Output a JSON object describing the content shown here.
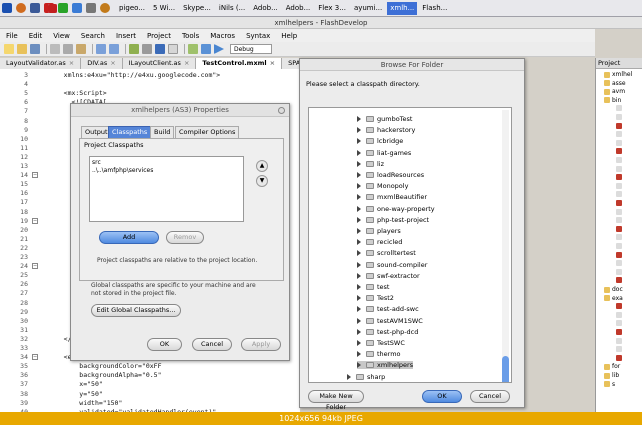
{
  "taskbar": {
    "tasks": [
      {
        "label": "pigeo..."
      },
      {
        "label": "5 Wi..."
      },
      {
        "label": "Skype..."
      },
      {
        "label": "iNils (..."
      },
      {
        "label": "Adob..."
      },
      {
        "label": "Adob..."
      },
      {
        "label": "Flex 3..."
      },
      {
        "label": "ayumi..."
      },
      {
        "label": "xmlh...",
        "active": true
      },
      {
        "label": "Flash..."
      }
    ]
  },
  "window": {
    "title": "xmlhelpers - FlashDevelop"
  },
  "menu": [
    "File",
    "Edit",
    "View",
    "Search",
    "Insert",
    "Project",
    "Tools",
    "Macros",
    "Syntax",
    "Help"
  ],
  "toolbar": {
    "config": "Debug"
  },
  "editor_tabs": [
    {
      "label": "LayoutValidator.as"
    },
    {
      "label": "DIV.as"
    },
    {
      "label": "ILayoutClient.as"
    },
    {
      "label": "TestControl.mxml",
      "active": true
    },
    {
      "label": "SPAN.as"
    }
  ],
  "code_lines": [
    {
      "n": "3",
      "t": "    xmlns:e4xu=\"http://e4xu.googlecode.com\">"
    },
    {
      "n": "4",
      "t": ""
    },
    {
      "n": "5",
      "t": "    <mx:Script>"
    },
    {
      "n": "6",
      "t": "      <![CDATA["
    },
    {
      "n": "7",
      "t": ""
    },
    {
      "n": "8",
      "t": ""
    },
    {
      "n": "9",
      "t": ""
    },
    {
      "n": "10",
      "t": ""
    },
    {
      "n": "11",
      "t": ""
    },
    {
      "n": "12",
      "t": ""
    },
    {
      "n": "13",
      "t": ""
    },
    {
      "n": "14",
      "t": ""
    },
    {
      "n": "15",
      "t": ""
    },
    {
      "n": "16",
      "t": ""
    },
    {
      "n": "17",
      "t": ""
    },
    {
      "n": "18",
      "t": ""
    },
    {
      "n": "19",
      "t": ""
    },
    {
      "n": "20",
      "t": ""
    },
    {
      "n": "21",
      "t": ""
    },
    {
      "n": "22",
      "t": ""
    },
    {
      "n": "23",
      "t": ""
    },
    {
      "n": "24",
      "t": ""
    },
    {
      "n": "25",
      "t": ""
    },
    {
      "n": "26",
      "t": ""
    },
    {
      "n": "27",
      "t": ""
    },
    {
      "n": "28",
      "t": ""
    },
    {
      "n": "29",
      "t": ""
    },
    {
      "n": "30",
      "t": ""
    },
    {
      "n": "31",
      "t": ""
    },
    {
      "n": "32",
      "t": "    </m"
    },
    {
      "n": "33",
      "t": ""
    },
    {
      "n": "34",
      "t": "    <e4"
    },
    {
      "n": "35",
      "t": "        backgroundColor=\"0xFF"
    },
    {
      "n": "36",
      "t": "        backgroundAlpha=\"0.5\""
    },
    {
      "n": "37",
      "t": "        x=\"50\""
    },
    {
      "n": "38",
      "t": "        y=\"50\""
    },
    {
      "n": "39",
      "t": "        width=\"150\""
    },
    {
      "n": "40",
      "t": "        validated=\"validatedHandler(event)\""
    }
  ],
  "right_panel": {
    "title": "Project",
    "items": [
      "xmlhel",
      "asse",
      "avm",
      "bin",
      "",
      "",
      "",
      "",
      "",
      "",
      "",
      "",
      "",
      "",
      "",
      "",
      "",
      "",
      "",
      "",
      "",
      "",
      "",
      "",
      "",
      "doc",
      "exa",
      "",
      "",
      "",
      "",
      "",
      "",
      "",
      "for",
      "lib",
      "s"
    ]
  },
  "properties_dialog": {
    "title": "xmlhelpers (AS3) Properties",
    "tabs": [
      "Output",
      "Classpaths",
      "Build",
      "Compiler Options"
    ],
    "active_tab": "Classpaths",
    "group_label": "Project Classpaths",
    "classpaths": [
      "src",
      "..\\..\\amfphp\\services"
    ],
    "add_label": "Add",
    "remove_label": "Remov",
    "relative_note": "Project classpaths are relative to the project location.",
    "global_note": "Global classpaths are specific to your machine and are not stored in the project file.",
    "edit_global_label": "Edit Global Classpaths...",
    "ok_label": "OK",
    "cancel_label": "Cancel",
    "apply_label": "Apply"
  },
  "browse_dialog": {
    "title": "Browse For Folder",
    "prompt": "Please select a classpath directory.",
    "folders": [
      "gumboTest",
      "hackerstory",
      "lcbridge",
      "liat-games",
      "liz",
      "loadResources",
      "Monopoly",
      "mxmlBeautifier",
      "one-way-property",
      "php-test-project",
      "players",
      "recicled",
      "scrolltertest",
      "sound-compiler",
      "swf-extractor",
      "test",
      "Test2",
      "test-add-swc",
      "testAVM1SWC",
      "test-php-dcd",
      "TestSWC",
      "thermo",
      "xmlhelpers",
      "sharp"
    ],
    "selected": "xmlhelpers",
    "new_folder_label": "Make New Folder",
    "ok_label": "OK",
    "cancel_label": "Cancel"
  },
  "status_strip": "1024x656  94kb  JPEG"
}
